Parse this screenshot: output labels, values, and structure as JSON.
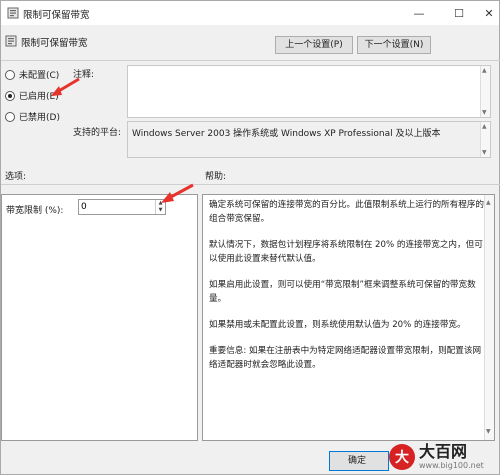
{
  "window": {
    "title": "限制可保留带宽",
    "controls": {
      "minimize": "—",
      "maximize": "☐",
      "close": "✕"
    }
  },
  "header": {
    "title": "限制可保留带宽",
    "prev_button": "上一个设置(P)",
    "next_button": "下一个设置(N)"
  },
  "state": {
    "options": [
      {
        "label": "未配置(C)",
        "selected": false
      },
      {
        "label": "已启用(E)",
        "selected": true
      },
      {
        "label": "已禁用(D)",
        "selected": false
      }
    ]
  },
  "comment": {
    "label": "注释:",
    "value": ""
  },
  "platform": {
    "label": "支持的平台:",
    "value": "Windows Server 2003 操作系统或 Windows XP Professional 及以上版本"
  },
  "sections": {
    "options_label": "选项:",
    "help_label": "帮助:"
  },
  "options_panel": {
    "bandwidth_label": "带宽限制 (%):",
    "bandwidth_value": "0"
  },
  "help": {
    "paragraphs": [
      "确定系统可保留的连接带宽的百分比。此值限制系统上运行的所有程序的组合带宽保留。",
      "默认情况下，数据包计划程序将系统限制在 20% 的连接带宽之内，但可以使用此设置来替代默认值。",
      "如果启用此设置，则可以使用“带宽限制”框来调整系统可保留的带宽数量。",
      "如果禁用或未配置此设置，则系统使用默认值为 20% 的连接带宽。",
      "重要信息: 如果在注册表中为特定网络适配器设置带宽限制，则配置该网络适配器时就会忽略此设置。"
    ]
  },
  "footer": {
    "ok_button": "确定"
  },
  "watermark": {
    "title": "大百网",
    "url": "www.big100.net"
  },
  "colors": {
    "arrow": "#e8322c",
    "accent": "#0078d7"
  },
  "icons": [
    "policy-icon",
    "spin-up-icon",
    "spin-down-icon",
    "red-arrow-icon"
  ]
}
